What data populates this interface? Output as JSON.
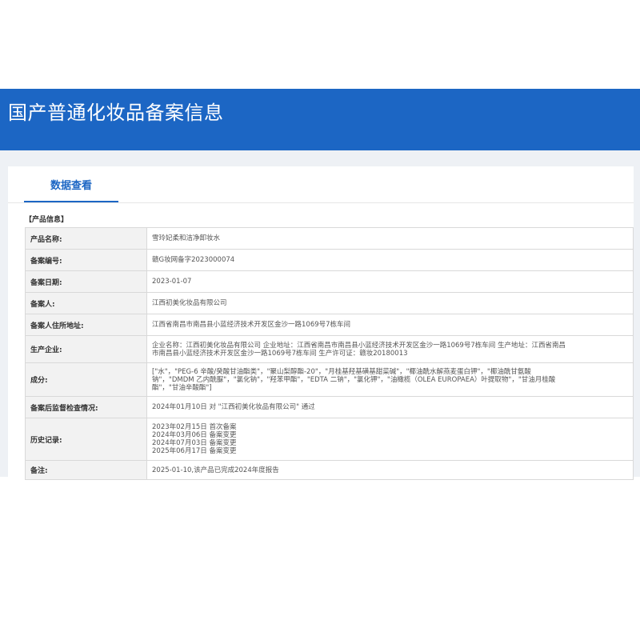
{
  "header": {
    "title": "国产普通化妆品备案信息"
  },
  "tabs": [
    {
      "label": "数据查看",
      "active": true
    }
  ],
  "section": {
    "label": "【产品信息】"
  },
  "rows": [
    {
      "label": "产品名称:",
      "value": "雪玲妃柔和洁净卸妆水"
    },
    {
      "label": "备案编号:",
      "value": "赣G妆网备字2023000074"
    },
    {
      "label": "备案日期:",
      "value": "2023-01-07"
    },
    {
      "label": "备案人:",
      "value": "江西初美化妆品有限公司"
    },
    {
      "label": "备案人住所地址:",
      "value": "江西省南昌市南昌县小蓝经济技术开发区金沙一路1069号7栋车间"
    },
    {
      "label": "生产企业:",
      "lines": [
        "企业名称：江西初美化妆品有限公司 企业地址：江西省南昌市南昌县小蓝经济技术开发区金沙一路1069号7栋车间 生产地址：江西省南昌",
        "市南昌县小蓝经济技术开发区金沙一路1069号7栋车间 生产许可证：赣妆20180013"
      ]
    },
    {
      "label": "成分:",
      "lines": [
        "[\"水\"，\"PEG-6 辛酸/癸酸甘油酯类\"，\"聚山梨醇酯-20\"，\"月桂基羟基磺基甜菜碱\"，\"椰油酰水解燕麦蛋白钾\"，\"椰油酰甘氨酸",
        "钠\"，\"DMDM 乙内酰脲\"，\"氯化钠\"，\"羟苯甲酯\"，\"EDTA 二钠\"，\"氯化钾\"，\"油橄榄（OLEA EUROPAEA）叶提取物\"，\"甘油月桂酸",
        "酯\"，\"甘油辛酸酯\"]"
      ]
    },
    {
      "label": "备案后监督检查情况:",
      "value": "2024年01月10日 对 \"江西初美化妆品有限公司\" 通过"
    },
    {
      "label": "历史记录:",
      "lines": [
        "2023年02月15日 首次备案",
        "2024年03月06日 备案变更",
        "2024年07月03日 备案变更",
        "2025年06月17日 备案变更"
      ]
    },
    {
      "label": "备注:",
      "value": "2025-01-10,该产品已完成2024年度报告"
    }
  ]
}
